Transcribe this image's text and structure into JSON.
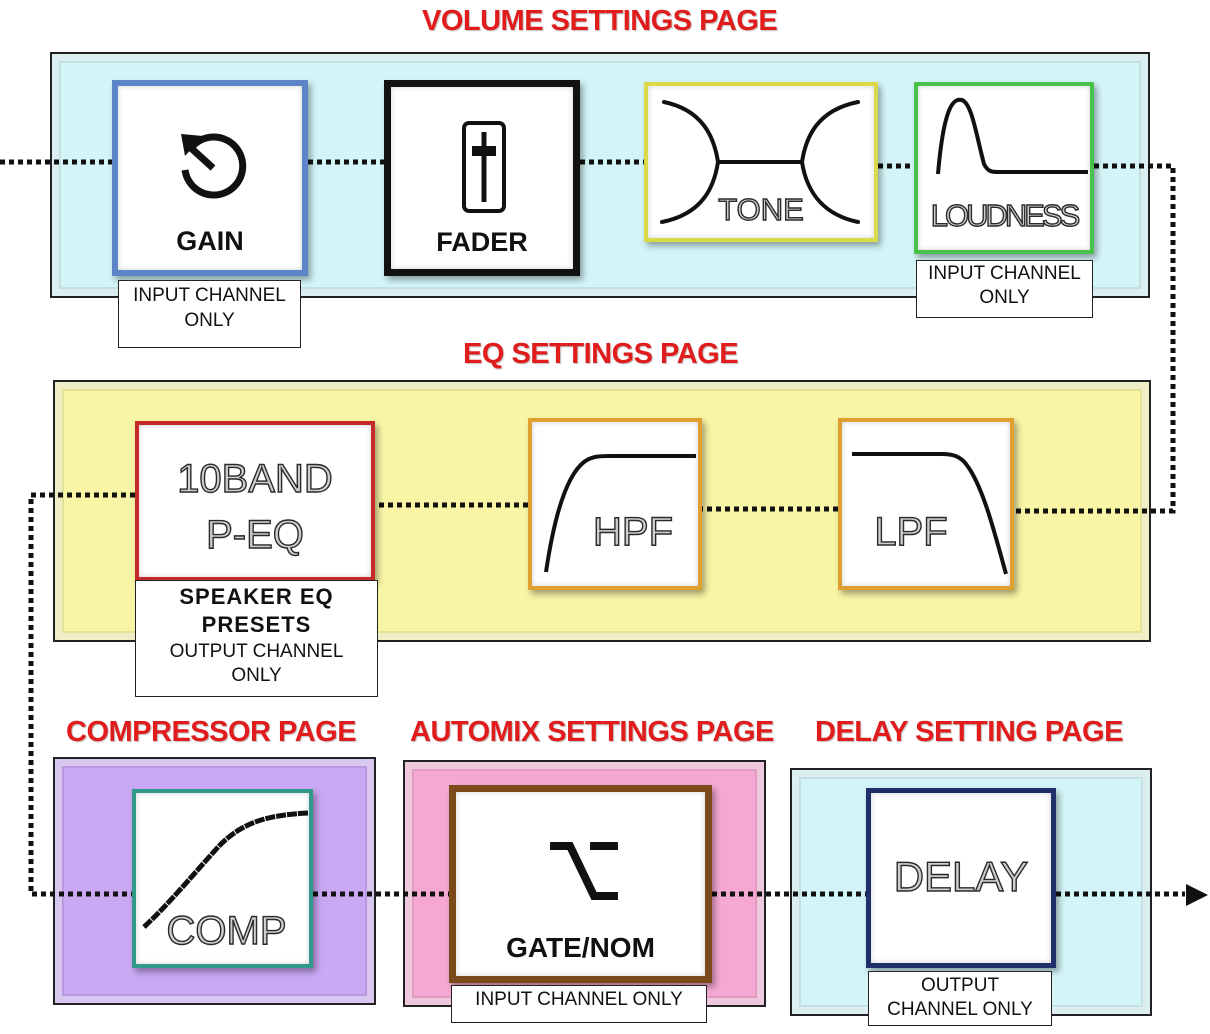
{
  "sections": {
    "volume": "VOLUME SETTINGS PAGE",
    "eq": "EQ SETTINGS PAGE",
    "compressor": "COMPRESSOR PAGE",
    "automix": "AUTOMIX SETTINGS PAGE",
    "delay": "DELAY SETTING PAGE"
  },
  "modules": {
    "gain": "GAIN",
    "fader": "FADER",
    "tone": "TONE",
    "loudness": "LOUDNESS",
    "peq_line1": "10BAND",
    "peq_line2": "P-EQ",
    "hpf": "HPF",
    "lpf": "LPF",
    "comp": "COMP",
    "gate": "GATE/NOM",
    "delay": "DELAY"
  },
  "notes": {
    "gain_line1": "INPUT CHANNEL",
    "gain_line2": "ONLY",
    "loudness_line1": "INPUT CHANNEL",
    "loudness_line2": "ONLY",
    "peq_line1": "SPEAKER EQ",
    "peq_line2": "PRESETS",
    "peq_line3": "OUTPUT CHANNEL",
    "peq_line4": "ONLY",
    "gate": "INPUT CHANNEL ONLY",
    "delay_line1": "OUTPUT",
    "delay_line2": "CHANNEL ONLY"
  },
  "colors": {
    "title": "#e01c1c",
    "volume_panel": "#d3f5f7",
    "eq_panel": "#f8f5a6",
    "comp_panel": "#c9a8f4",
    "automix_panel": "#f5a9d2",
    "delay_panel": "#d3f5f7",
    "gain_border": "#5b85c8",
    "fader_border": "#111111",
    "tone_border": "#d9d94a",
    "loudness_border": "#48c24a",
    "peq_border": "#c42a2a",
    "hpf_border": "#e0a030",
    "lpf_border": "#e0a030",
    "comp_border": "#2f9a8a",
    "gate_border": "#7a4a1c",
    "delay_border": "#1f2f6a"
  },
  "icons": [
    "gain-knob-icon",
    "fader-slider-icon",
    "tone-curve-icon",
    "loudness-curve-icon",
    "hpf-curve-icon",
    "lpf-curve-icon",
    "compressor-curve-icon",
    "gate-switch-icon",
    "output-arrow-icon"
  ]
}
